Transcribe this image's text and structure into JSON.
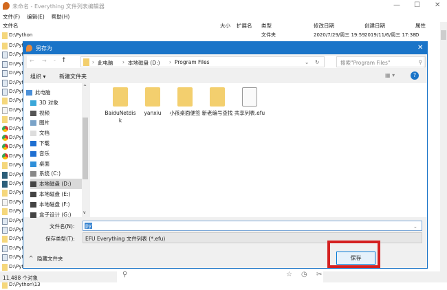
{
  "window": {
    "title": "未命名 - Everything 文件列表编辑器",
    "min": "—",
    "max": "☐",
    "close": "✕"
  },
  "menu": [
    "文件(F)",
    "编辑(E)",
    "帮助(H)"
  ],
  "columns": {
    "name": "文件名",
    "size": "大小",
    "ext": "扩展名",
    "type": "类型",
    "modified": "修改日期",
    "created": "创建日期",
    "attr": "属性"
  },
  "first_row": {
    "name": "D:\\Python",
    "type": "文件夹",
    "modified": "2020/7/29/周三 19:59",
    "created": "2019/11/6/周三 17:38",
    "attr": "D"
  },
  "rows": [
    {
      "icon": "folder",
      "name": "D:\\Pyt"
    },
    {
      "icon": "py",
      "name": "D:\\Pyt"
    },
    {
      "icon": "py",
      "name": "D:\\Pyt"
    },
    {
      "icon": "py",
      "name": "D:\\Pyt"
    },
    {
      "icon": "py",
      "name": "D:\\Pyt"
    },
    {
      "icon": "py",
      "name": "D:\\Pyt"
    },
    {
      "icon": "folder",
      "name": "D:\\Pyt"
    },
    {
      "icon": "doc",
      "name": "D:\\Pyt"
    },
    {
      "icon": "folder",
      "name": "D:\\Pyt"
    },
    {
      "icon": "chrome",
      "name": "D:\\Pyt"
    },
    {
      "icon": "chrome",
      "name": "D:\\Pyt"
    },
    {
      "icon": "chrome",
      "name": "D:\\Pyt"
    },
    {
      "icon": "chrome",
      "name": "D:\\Pyt"
    },
    {
      "icon": "folder",
      "name": "D:\\Pyt"
    },
    {
      "icon": "pyc",
      "name": "D:\\Pyt"
    },
    {
      "icon": "pyc",
      "name": "D:\\Pyt"
    },
    {
      "icon": "folder",
      "name": "D:\\Pyt"
    },
    {
      "icon": "doc",
      "name": "D:\\Pyt"
    },
    {
      "icon": "folder",
      "name": "D:\\Pyt"
    },
    {
      "icon": "py",
      "name": "D:\\Pyt"
    },
    {
      "icon": "py",
      "name": "D:\\Pyt"
    },
    {
      "icon": "folder",
      "name": "D:\\Pyt"
    },
    {
      "icon": "py",
      "name": "D:\\Pyt"
    },
    {
      "icon": "py",
      "name": "D:\\Pyt"
    },
    {
      "icon": "folder",
      "name": "D:\\Pyt"
    },
    {
      "icon": "pyc",
      "name": "D:\\Pyt"
    },
    {
      "icon": "folder",
      "name": "D:\\Python\\13"
    }
  ],
  "dialog": {
    "title": "另存为",
    "close": "✕",
    "breadcrumb": [
      "此电脑",
      "本地磁盘 (D:)",
      "Program Files"
    ],
    "search_placeholder": "搜索\"Program Files\"",
    "organize": "组织 ▾",
    "new_folder": "新建文件夹",
    "nav": [
      "此电脑",
      "3D 对象",
      "视频",
      "图片",
      "文档",
      "下载",
      "音乐",
      "桌面",
      "系统 (C:)",
      "本地磁盘 (D:)",
      "本地磁盘 (E:)",
      "本地磁盘 (F:)",
      "盒子设计 (G:)"
    ],
    "items": [
      {
        "label": "BaiduNetdisk",
        "kind": "folder"
      },
      {
        "label": "yanxiu",
        "kind": "folder"
      },
      {
        "label": "小孩桌面便签",
        "kind": "folder"
      },
      {
        "label": "新老编号查找",
        "kind": "folder"
      },
      {
        "label": "共享列表.efu",
        "kind": "file"
      }
    ],
    "filename_label": "文件名(N):",
    "filename_value": "py",
    "filetype_label": "保存类型(T):",
    "filetype_value": "EFU Everything 文件列表 (*.efu)",
    "hide_folders": "隐藏文件夹",
    "save": "保存"
  },
  "status": "11,488 个对象",
  "accent": "#1a74c8",
  "highlight": "#d42020"
}
